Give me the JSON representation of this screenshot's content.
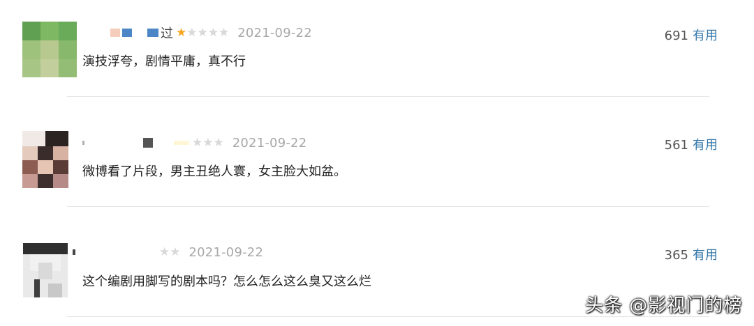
{
  "reviews": [
    {
      "username_visible": "过",
      "rating": 1,
      "date": "2021-09-22",
      "votes": "691",
      "vote_label": "有用",
      "comment": "演技浮夸，剧情平庸，真不行"
    },
    {
      "username_visible": "",
      "rating": 3,
      "date": "2021-09-22",
      "votes": "561",
      "vote_label": "有用",
      "comment": "微博看了片段，男主丑绝人寰，女主脸大如盆。"
    },
    {
      "username_visible": "",
      "rating": 2,
      "date": "2021-09-22",
      "votes": "365",
      "vote_label": "有用",
      "comment": "这个编剧用脚写的剧本吗？怎么怎么这么臭又这么烂"
    }
  ],
  "watermark": "头条 @影视门的榜",
  "colors": {
    "star_filled": "#f5a623",
    "star_empty": "#d8d8d8",
    "link": "#3377aa",
    "divider": "#e6e6e6"
  }
}
